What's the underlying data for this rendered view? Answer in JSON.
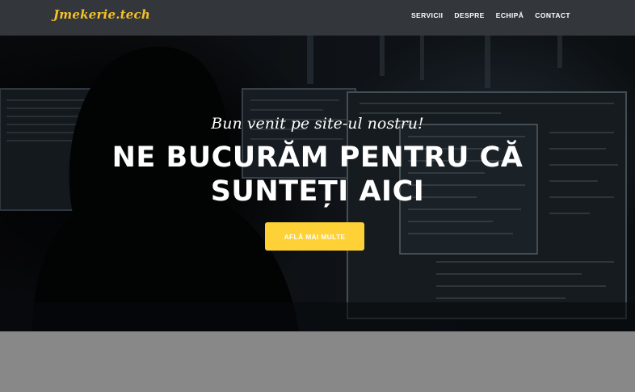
{
  "navbar": {
    "brand": "Jmekerie.tech",
    "links": [
      "SERVICII",
      "DESPRE",
      "ECHIPĂ",
      "CONTACT"
    ]
  },
  "hero": {
    "subtitle": "Bun venit pe site-ul nostru!",
    "title_line1": "NE BUCURĂM PENTRU CĂ",
    "title_line2": "SUNTEȚI AICI",
    "cta_label": "AFLĂ MAI MULTE"
  },
  "colors": {
    "navbar_bg": "#33363b",
    "brand": "#f5c12a",
    "cta_bg": "#fed136",
    "lower_section_bg": "#888888"
  }
}
